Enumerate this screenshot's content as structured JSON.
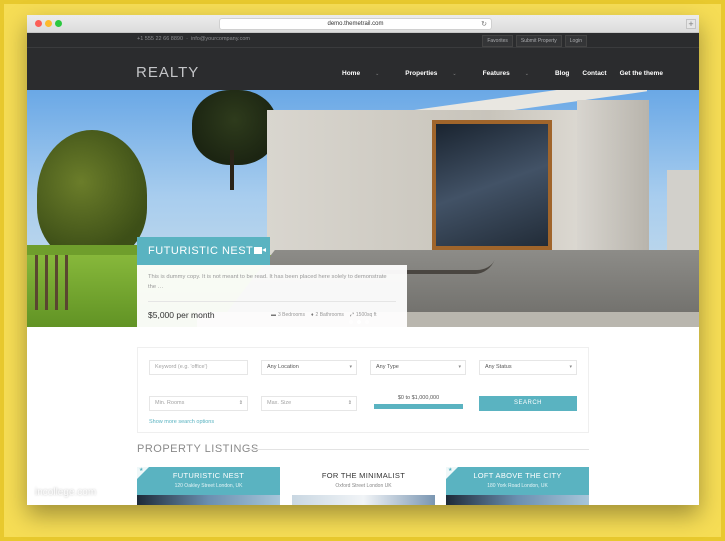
{
  "browser": {
    "url": "demo.themetrail.com"
  },
  "topbar": {
    "phone": "+1 555 22 66 8890",
    "email": "info@yourcompany.com",
    "links": [
      "Favorites",
      "Submit Property",
      "Login"
    ]
  },
  "header": {
    "logo": "REALTY",
    "nav": [
      "Home",
      "Properties",
      "Features",
      "Blog",
      "Contact",
      "Get the theme"
    ]
  },
  "hero": {
    "title": "FUTURISTIC NEST",
    "description": "This is dummy copy. It is not meant to be read. It has been placed here solely to demonstrate the …",
    "price": "$5,000  per month",
    "bedrooms": "3 Bedrooms",
    "bathrooms": "2 Bathrooms",
    "area": "1500sq ft",
    "slide_count": 3,
    "active_slide": 2
  },
  "search": {
    "keyword_placeholder": "Keyword (e.g. 'office')",
    "location": "Any Location",
    "type": "Any Type",
    "status": "Any Status",
    "min_rooms": "Min. Rooms",
    "max_size": "Max. Size",
    "price_range": "$0 to $1,000,000",
    "button": "SEARCH",
    "more_link": "Show more search options"
  },
  "listings": {
    "title": "PROPERTY LISTINGS",
    "cards": [
      {
        "name": "FUTURISTIC NEST",
        "address": "120 Oakley Street London, UK",
        "featured": true
      },
      {
        "name": "FOR THE MINIMALIST",
        "address": "Oxford Street London UK",
        "featured": false
      },
      {
        "name": "LOFT ABOVE THE CITY",
        "address": "180 York Road London, UK",
        "featured": true
      }
    ]
  },
  "watermark": "incollege.com",
  "colors": {
    "accent": "#5ab3c1",
    "header_bg": "#2b2c2e",
    "frame": "#f6dd55"
  }
}
